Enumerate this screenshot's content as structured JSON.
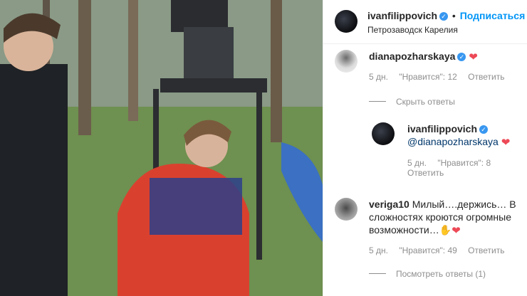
{
  "post": {
    "author": "ivanfilippovich",
    "follow_sep": "•",
    "follow_label": "Подписаться",
    "location": "Петрозаводск Карелия"
  },
  "comments": [
    {
      "user": "dianapozharskaya",
      "time": "5 дн.",
      "likes": "\"Нравится\": 12",
      "reply": "Ответить",
      "toggle_replies": "Скрыть ответы"
    },
    {
      "user": "ivanfilippovich",
      "mention": "@dianapozharskaya",
      "time": "5 дн.",
      "likes": "\"Нравится\": 8",
      "reply": "Ответить"
    },
    {
      "user": "veriga10",
      "text_line1": "Милый….держись… В",
      "text_line2": "сложностях кроются огромные",
      "text_line3": "возможности…",
      "time": "5 дн.",
      "likes": "\"Нравится\": 49",
      "reply": "Ответить",
      "toggle_replies": "Посмотреть ответы (1)"
    }
  ],
  "icons": {
    "verified": "verified-badge-icon",
    "heart": "heart-icon",
    "hand": "raised-hand-icon"
  },
  "colors": {
    "link_blue": "#0095f6",
    "verified_blue": "#3897f0",
    "heart_red": "#ed4956",
    "meta_gray": "#8e8e8e"
  }
}
